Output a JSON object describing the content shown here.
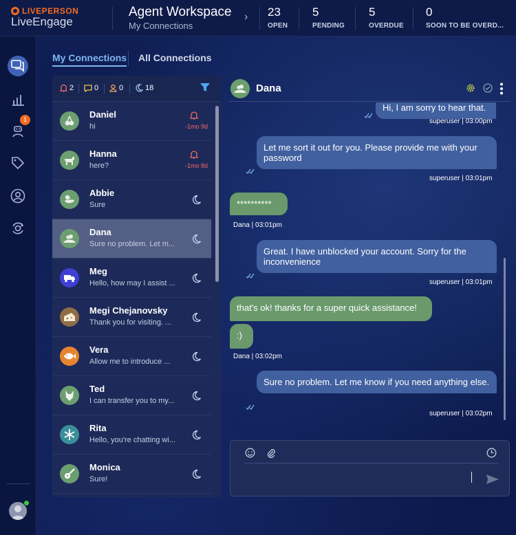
{
  "brand": {
    "company": "LIVEPERSON",
    "product": "LiveEngage"
  },
  "workspace": {
    "title": "Agent Workspace",
    "subtitle": "My Connections"
  },
  "stats": [
    {
      "value": "23",
      "label": "OPEN"
    },
    {
      "value": "5",
      "label": "PENDING"
    },
    {
      "value": "5",
      "label": "OVERDUE"
    },
    {
      "value": "0",
      "label": "SOON TO BE OVERD..."
    }
  ],
  "nav": {
    "badge_count": "1"
  },
  "tabs": {
    "active": "My Connections",
    "inactive": "All Connections"
  },
  "list_header": {
    "alerts": "2",
    "messages": "0",
    "users": "0",
    "idle": "18"
  },
  "conversations": [
    {
      "name": "Daniel",
      "preview": "hi",
      "status": "alert",
      "age": "-1mo 9d",
      "avatar": "cherry-icon"
    },
    {
      "name": "Hanna",
      "preview": "here?",
      "status": "alert",
      "age": "-1mo 8d",
      "avatar": "dog-icon"
    },
    {
      "name": "Abbie",
      "preview": "Sure",
      "status": "idle",
      "age": "",
      "avatar": "duck-icon"
    },
    {
      "name": "Dana",
      "preview": "Sure no problem. Let m...",
      "status": "idle",
      "age": "",
      "avatar": "cloud-hill-icon"
    },
    {
      "name": "Meg",
      "preview": "Hello, how may I assist ...",
      "status": "idle",
      "age": "",
      "avatar": "truck-icon"
    },
    {
      "name": "Megi Chejanovsky",
      "preview": "Thank you for visiting. ...",
      "status": "idle",
      "age": "",
      "avatar": "cheese-icon"
    },
    {
      "name": "Vera",
      "preview": "Allow me to introduce ...",
      "status": "idle",
      "age": "",
      "avatar": "fish-icon"
    },
    {
      "name": "Ted",
      "preview": "I can transfer you to my...",
      "status": "idle",
      "age": "",
      "avatar": "wolf-icon"
    },
    {
      "name": "Rita",
      "preview": "Hello, you're chatting wi...",
      "status": "idle",
      "age": "",
      "avatar": "snowflake-icon"
    },
    {
      "name": "Monica",
      "preview": "Sure!",
      "status": "idle",
      "age": "",
      "avatar": "guitar-icon"
    }
  ],
  "chat": {
    "name": "Dana",
    "messages": [
      {
        "from": "agent",
        "text": "Hi, I am sorry to hear that.",
        "meta": "superuser  |  03:00pm"
      },
      {
        "from": "agent",
        "text": "Let me sort it out for you. Please provide me with your password",
        "meta": "superuser  |  03:01pm"
      },
      {
        "from": "consumer",
        "text": "**********",
        "meta": "Dana  |  03:01pm"
      },
      {
        "from": "agent",
        "text": "Great. I have unblocked your account. Sorry for the inconvenience",
        "meta": "superuser  |  03:01pm"
      },
      {
        "from": "consumer",
        "text": "that's ok! thanks for a super quick assistance!",
        "meta": ""
      },
      {
        "from": "consumer",
        "text": ":)",
        "meta": "Dana  |  03:02pm"
      },
      {
        "from": "agent",
        "text": "Sure no problem. Let me know if you need anything else.",
        "meta": "superuser  |  03:02pm"
      }
    ]
  },
  "colors": {
    "accent": "#7fb6ee",
    "brand_orange": "#f26b24",
    "agent_bubble": "#41609f",
    "consumer_bubble": "#6a9a6c",
    "alert_red": "#f26a63"
  }
}
